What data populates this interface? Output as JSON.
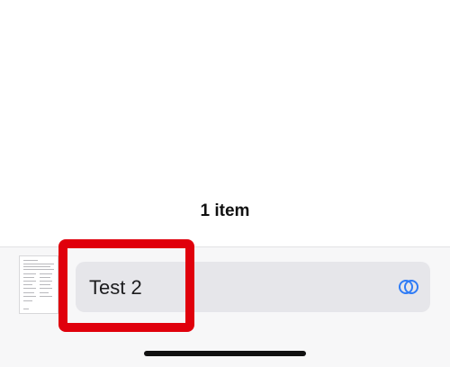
{
  "content": {
    "item_count": "1 item"
  },
  "bottom_bar": {
    "name_field_value": "Test 2"
  },
  "colors": {
    "highlight": "#e0000c",
    "accent": "#2f7cf6"
  },
  "icons": {
    "thumbnail": "document-thumbnail",
    "toggle": "toggle-circles-icon"
  }
}
